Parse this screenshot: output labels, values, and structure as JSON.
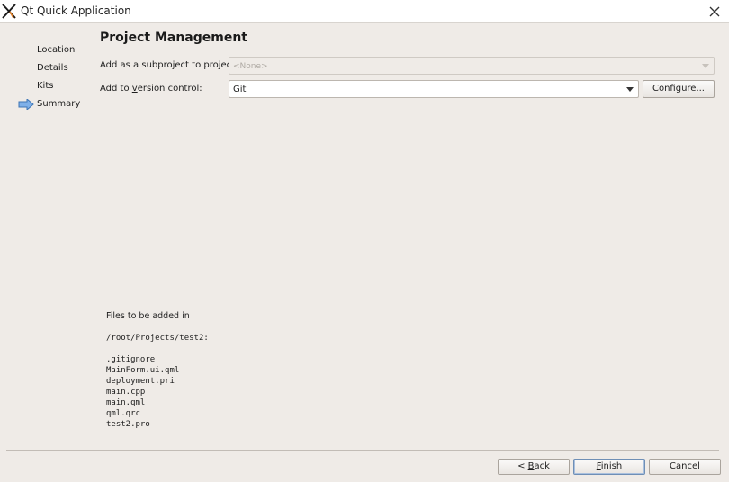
{
  "window": {
    "title": "Qt Quick Application"
  },
  "wizard": {
    "steps": [
      "Location",
      "Details",
      "Kits",
      "Summary"
    ],
    "current_step": "Summary"
  },
  "page": {
    "title": "Project Management",
    "subproject": {
      "label": "Add as a subproject to project:",
      "value": "<None>"
    },
    "version_control": {
      "label_pre": "Add to ",
      "label_mnemonic": "v",
      "label_post": "ersion control:",
      "value": "Git"
    },
    "configure_label": "Configure..."
  },
  "files": {
    "heading": "Files to be added in",
    "path": "/root/Projects/test2:",
    "items": [
      ".gitignore",
      "MainForm.ui.qml",
      "deployment.pri",
      "main.cpp",
      "main.qml",
      "qml.qrc",
      "test2.pro"
    ]
  },
  "buttons": {
    "back_pre": "< ",
    "back_mnemonic": "B",
    "back_post": "ack",
    "finish_mnemonic": "F",
    "finish_post": "inish",
    "cancel": "Cancel"
  },
  "colors": {
    "background": "#efebe7",
    "accent": "#4a90d9"
  }
}
